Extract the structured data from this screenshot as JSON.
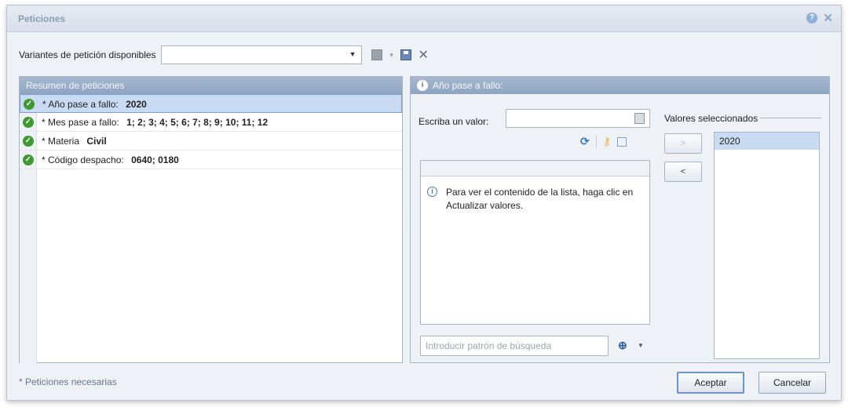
{
  "dialog": {
    "title": "Peticiones",
    "help_icon": "question-icon",
    "close_icon": "close-icon"
  },
  "variants": {
    "label": "Variantes de petición disponibles",
    "selected_value": "",
    "icons": [
      "grid-icon",
      "dropdown-arrow-icon",
      "save-icon",
      "delete-icon"
    ]
  },
  "summary": {
    "header": "Resumen de peticiones",
    "items": [
      {
        "label": "* Año pase a fallo:",
        "value": "2020",
        "status": "complete"
      },
      {
        "label": "* Mes pase a fallo:",
        "value": "1; 2; 3; 4; 5; 6; 7; 8; 9; 10; 11; 12",
        "status": "complete"
      },
      {
        "label": "* Materia",
        "value": "Civil",
        "status": "complete"
      },
      {
        "label": "* Código despacho:",
        "value": "0640; 0180",
        "status": "complete"
      }
    ]
  },
  "detail": {
    "header": "Año pase a fallo:",
    "value_label": "Escriba un valor:",
    "value_input": "",
    "list_message": "Para ver el contenido de la lista, haga clic en Actualizar valores.",
    "search_placeholder": "Introducir patrón de búsqueda",
    "add_button": ">",
    "remove_button": "<",
    "selected_title": "Valores seleccionados",
    "selected_values": [
      "2020"
    ]
  },
  "footer": {
    "note": "* Peticiones necesarias",
    "ok_button": "Aceptar",
    "cancel_button": "Cancelar"
  }
}
